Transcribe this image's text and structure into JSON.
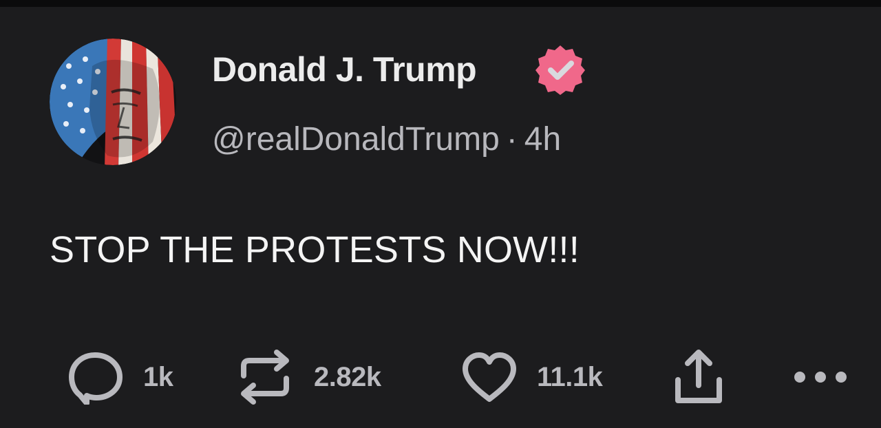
{
  "post": {
    "author": {
      "display_name": "Donald J. Trump",
      "handle": "@realDonaldTrump",
      "verified": true,
      "badge_color": "#f0688a",
      "avatar_icon": "flag-face-avatar"
    },
    "separator": "·",
    "timestamp": "4h",
    "text": "STOP THE PROTESTS NOW!!!",
    "actions": {
      "reply": {
        "icon": "reply-bubble-icon",
        "count": "1k"
      },
      "repost": {
        "icon": "repost-arrows-icon",
        "count": "2.82k"
      },
      "like": {
        "icon": "heart-icon",
        "count": "11.1k"
      },
      "share": {
        "icon": "share-icon"
      },
      "more": {
        "icon": "more-dots-icon"
      }
    }
  },
  "colors": {
    "background": "#1c1c1e",
    "text_primary": "#ececec",
    "text_secondary": "#b8b8bd",
    "badge": "#f0688a"
  }
}
